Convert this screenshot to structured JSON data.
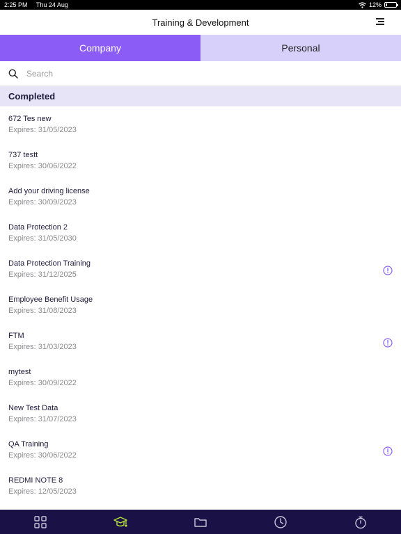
{
  "status": {
    "time": "2:25 PM",
    "date": "Thu 24 Aug",
    "battery": "12%",
    "battery_level": 0.12
  },
  "header": {
    "title": "Training & Development"
  },
  "tabs": [
    {
      "label": "Company",
      "active": true
    },
    {
      "label": "Personal",
      "active": false
    }
  ],
  "search": {
    "placeholder": "Search",
    "value": ""
  },
  "section": {
    "title": "Completed"
  },
  "items": [
    {
      "title": "672 Tes new",
      "expires": "Expires: 31/05/2023",
      "alert": false
    },
    {
      "title": "737 testt",
      "expires": "Expires: 30/06/2022",
      "alert": false
    },
    {
      "title": "Add your driving license",
      "expires": "Expires: 30/09/2023",
      "alert": false
    },
    {
      "title": "Data Protection 2",
      "expires": "Expires: 31/05/2030",
      "alert": false
    },
    {
      "title": "Data Protection Training",
      "expires": "Expires: 31/12/2025",
      "alert": true
    },
    {
      "title": "Employee Benefit Usage",
      "expires": "Expires: 31/08/2023",
      "alert": false
    },
    {
      "title": "FTM",
      "expires": "Expires: 31/03/2023",
      "alert": true
    },
    {
      "title": "mytest",
      "expires": "Expires: 30/09/2022",
      "alert": false
    },
    {
      "title": "New Test Data",
      "expires": "Expires: 31/07/2023",
      "alert": false
    },
    {
      "title": "QA Training",
      "expires": "Expires: 30/06/2022",
      "alert": true
    },
    {
      "title": "REDMI NOTE 8",
      "expires": "Expires: 12/05/2023",
      "alert": false
    }
  ],
  "bottom_nav": [
    {
      "icon": "grid-icon",
      "active": false
    },
    {
      "icon": "graduation-cap-icon",
      "active": true
    },
    {
      "icon": "folder-icon",
      "active": false
    },
    {
      "icon": "clock-icon",
      "active": false
    },
    {
      "icon": "stopwatch-icon",
      "active": false
    }
  ],
  "colors": {
    "accent": "#8b5cf6",
    "tab_inactive": "#d6d0fb",
    "section_bg": "#e7e4f8",
    "nav_bg": "#1a1147",
    "alert": "#8b5cf6",
    "nav_active": "#b6e33a",
    "nav_inactive": "#c9c6d9"
  }
}
